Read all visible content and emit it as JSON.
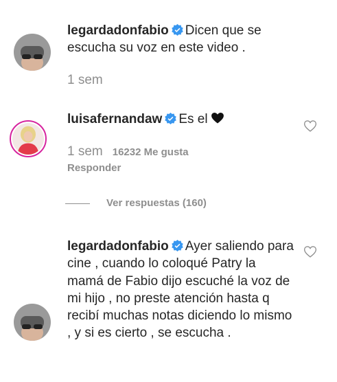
{
  "comments": [
    {
      "username": "legardadonfabio",
      "text": "Dicen que se escucha su voz en este video .",
      "time": "1 sem"
    },
    {
      "username": "luisafernandaw",
      "text": "Es el ",
      "emoji": "black-heart",
      "time": "1 sem",
      "likes": "16232 Me gusta",
      "reply_label": "Responder"
    },
    {
      "username": "legardadonfabio",
      "text": "Ayer saliendo para cine , cuando lo coloqué Patry la mamá de Fabio dijo escuché la voz de mi hijo , no preste atención hasta q recibí muchas notas diciendo lo mismo , y si es cierto , se escucha ."
    }
  ],
  "view_replies": "Ver respuestas (160)",
  "colors": {
    "verified": "#3897f0",
    "muted": "#8e8e8e",
    "text": "#262626",
    "ring": "#d6249f"
  }
}
